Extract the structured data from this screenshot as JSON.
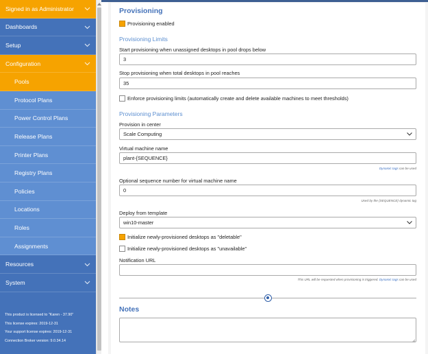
{
  "sidebar": {
    "items": [
      {
        "label": "Signed in as Administrator",
        "style": "orange",
        "chevron": true
      },
      {
        "label": "Dashboards",
        "style": "blue",
        "chevron": true
      },
      {
        "label": "Setup",
        "style": "blue",
        "chevron": true
      },
      {
        "label": "Configuration",
        "style": "orange",
        "chevron": true
      },
      {
        "label": "Pools",
        "style": "sub-active",
        "chevron": false
      },
      {
        "label": "Protocol Plans",
        "style": "sub",
        "chevron": false
      },
      {
        "label": "Power Control Plans",
        "style": "sub",
        "chevron": false
      },
      {
        "label": "Release Plans",
        "style": "sub",
        "chevron": false
      },
      {
        "label": "Printer Plans",
        "style": "sub",
        "chevron": false
      },
      {
        "label": "Registry Plans",
        "style": "sub",
        "chevron": false
      },
      {
        "label": "Policies",
        "style": "sub",
        "chevron": false
      },
      {
        "label": "Locations",
        "style": "sub",
        "chevron": false
      },
      {
        "label": "Roles",
        "style": "sub",
        "chevron": false
      },
      {
        "label": "Assignments",
        "style": "sub",
        "chevron": false
      },
      {
        "label": "Resources",
        "style": "blue",
        "chevron": true
      },
      {
        "label": "System",
        "style": "blue",
        "chevron": true
      }
    ],
    "license": {
      "licensed_to": "This product is licensed to \"Karen - 37.90\"",
      "license_expires": "This license expires: 2019-12-31",
      "support_expires": "Your support license expires: 2019-12-31",
      "broker_version": "Connection Broker version: 9.0.34.14"
    }
  },
  "provisioning": {
    "title": "Provisioning",
    "enabled_label": "Provisioning enabled",
    "enabled": true,
    "limits_title": "Provisioning Limits",
    "start_label": "Start provisioning when unassigned desktops in pool drops below",
    "start_value": "3",
    "stop_label": "Stop provisioning when total desktops in pool reaches",
    "stop_value": "35",
    "enforce_label": "Enforce provisioning limits (automatically create and delete available machines to meet thresholds)",
    "enforce": false,
    "params_title": "Provisioning Parameters",
    "center_label": "Provision in center",
    "center_value": "Scale Computing",
    "vm_name_label": "Virtual machine name",
    "vm_name_value": "plant-{SEQUENCE}",
    "vm_name_hint_link": "Dynamic tags",
    "vm_name_hint_rest": " can be used",
    "seq_label": "Optional sequence number for virtual machine name",
    "seq_value": "0",
    "seq_hint": "Used by the {SEQUENCE} dynamic tag",
    "template_label": "Deploy from template",
    "template_value": "win10-master",
    "deletable_label": "Initialize newly-provisioned desktops as \"deletable\"",
    "deletable": true,
    "unavailable_label": "Initialize newly-provisioned desktops as \"unavailable\"",
    "unavailable": false,
    "notify_label": "Notification URL",
    "notify_value": "",
    "notify_hint_pre": "This URL will be requested when provisioning is triggered. ",
    "notify_hint_link": "Dynamic tags",
    "notify_hint_post": " can be used"
  },
  "notes": {
    "title": "Notes",
    "value": ""
  },
  "colors": {
    "accent_orange": "#f6a300",
    "sidebar_blue": "#4472b9",
    "sub_blue": "#5f8fd2",
    "heading_blue": "#4472b9"
  }
}
